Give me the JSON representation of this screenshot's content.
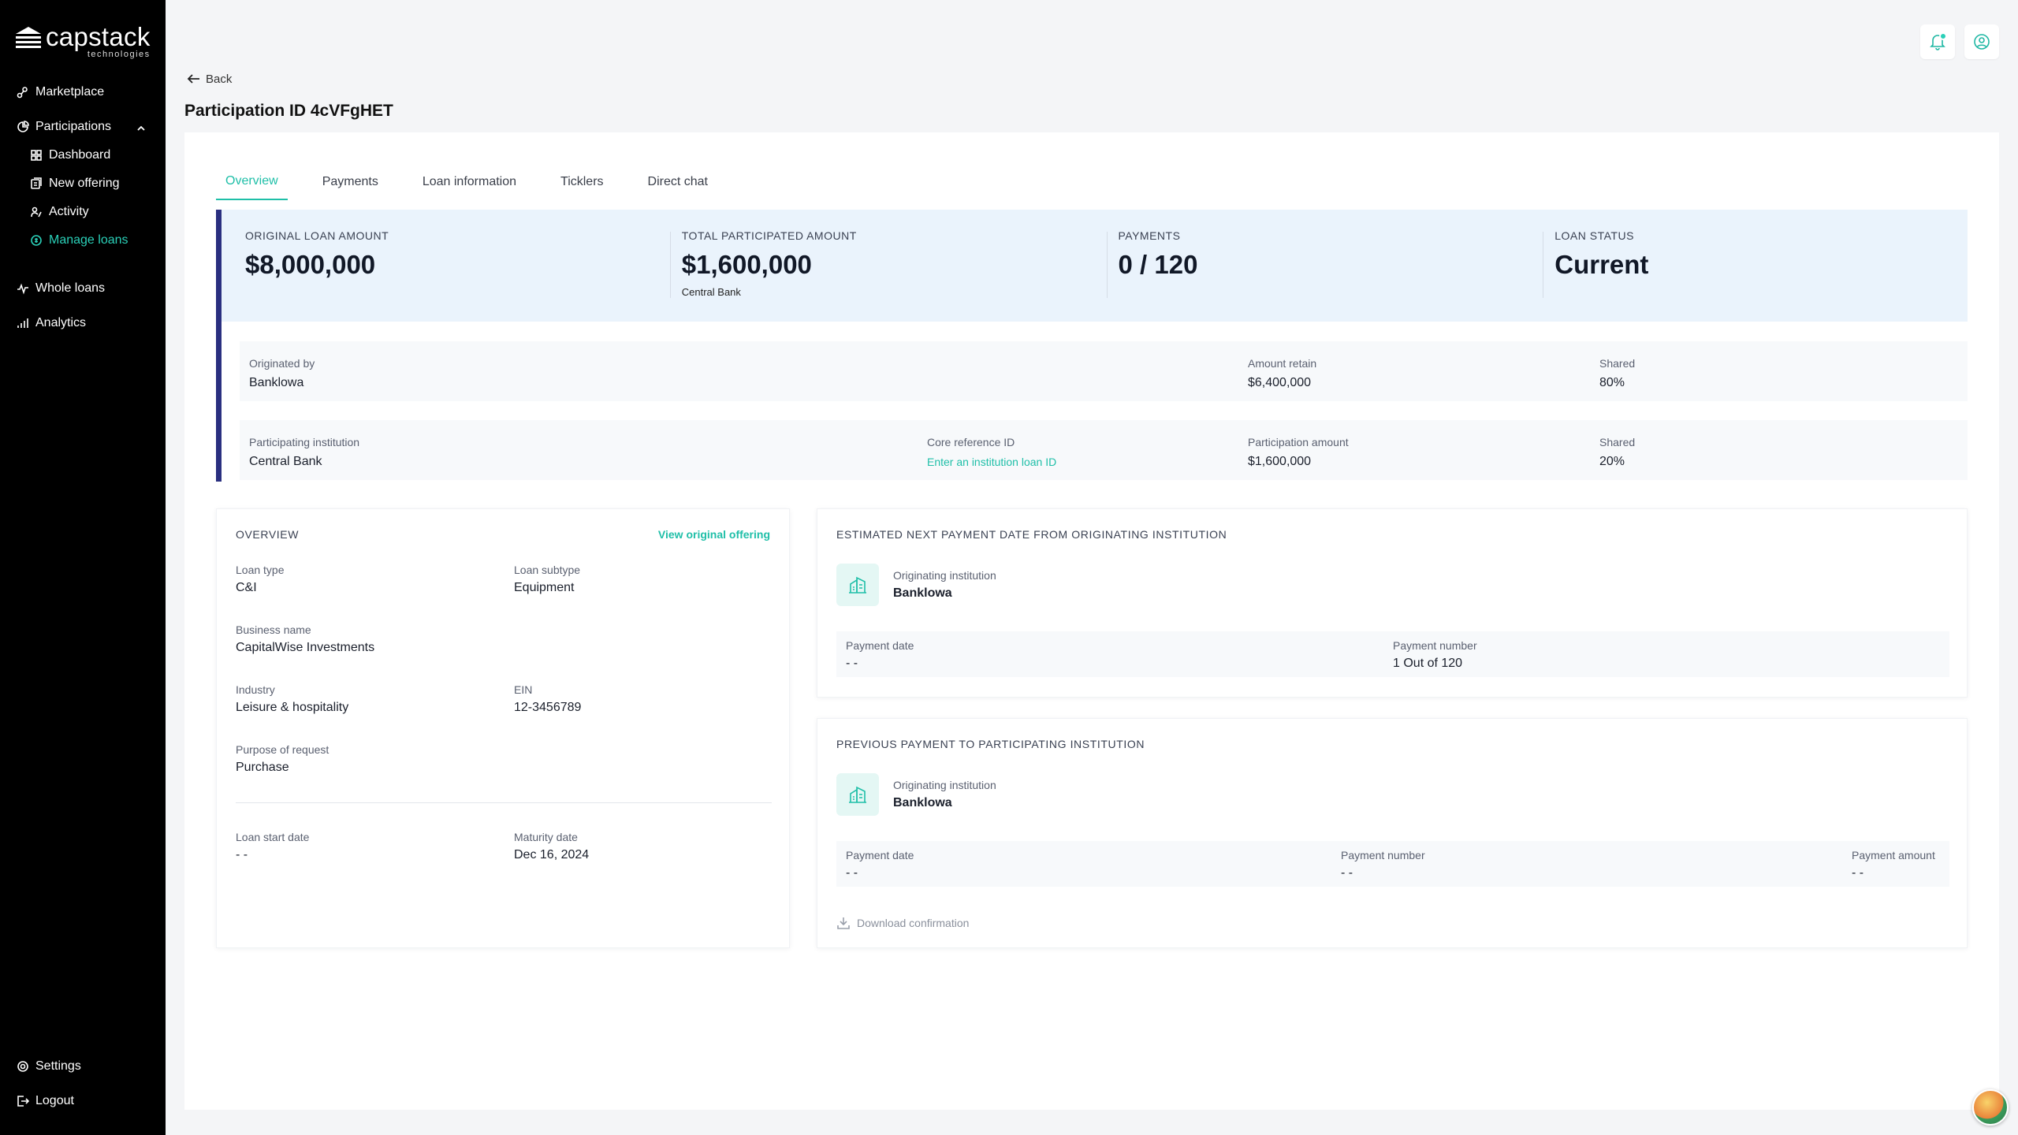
{
  "brand": {
    "name": "capstack",
    "sub": "technologies"
  },
  "nav": {
    "marketplace": "Marketplace",
    "participations": "Participations",
    "dashboard": "Dashboard",
    "new_offering": "New offering",
    "activity": "Activity",
    "manage_loans": "Manage loans",
    "whole_loans": "Whole loans",
    "analytics": "Analytics",
    "settings": "Settings",
    "logout": "Logout"
  },
  "header": {
    "back": "Back",
    "title": "Participation ID 4cVFgHET"
  },
  "tabs": [
    "Overview",
    "Payments",
    "Loan information",
    "Ticklers",
    "Direct chat"
  ],
  "stats": {
    "original_label": "ORIGINAL LOAN AMOUNT",
    "original_value": "$8,000,000",
    "participated_label": "TOTAL PARTICIPATED AMOUNT",
    "participated_value": "$1,600,000",
    "participated_sub": "Central Bank",
    "payments_label": "PAYMENTS",
    "payments_value": "0 / 120",
    "status_label": "LOAN STATUS",
    "status_value": "Current"
  },
  "origination": {
    "originated_by_label": "Originated by",
    "originated_by": "Banklowa",
    "amount_retain_label": "Amount retain",
    "amount_retain": "$6,400,000",
    "shared_label": "Shared",
    "shared": "80%"
  },
  "participation": {
    "institution_label": "Participating institution",
    "institution": "Central Bank",
    "core_ref_label": "Core reference ID",
    "core_ref_link": "Enter an institution loan ID",
    "amount_label": "Participation amount",
    "amount": "$1,600,000",
    "shared_label": "Shared",
    "shared": "20%"
  },
  "overview": {
    "title": "OVERVIEW",
    "link": "View original offering",
    "loan_type_label": "Loan type",
    "loan_type": "C&I",
    "loan_subtype_label": "Loan subtype",
    "loan_subtype": "Equipment",
    "business_label": "Business name",
    "business": "CapitalWise Investments",
    "industry_label": "Industry",
    "industry": "Leisure & hospitality",
    "ein_label": "EIN",
    "ein": "12-3456789",
    "purpose_label": "Purpose of request",
    "purpose": "Purchase",
    "start_label": "Loan start date",
    "start": "- -",
    "maturity_label": "Maturity date",
    "maturity": "Dec 16, 2024"
  },
  "next_payment": {
    "title": "ESTIMATED NEXT PAYMENT DATE FROM ORIGINATING INSTITUTION",
    "inst_label": "Originating institution",
    "inst_name": "Banklowa",
    "date_label": "Payment date",
    "date": "- -",
    "number_label": "Payment number",
    "number": "1 Out of 120"
  },
  "prev_payment": {
    "title": "PREVIOUS PAYMENT TO PARTICIPATING INSTITUTION",
    "inst_label": "Originating institution",
    "inst_name": "Banklowa",
    "date_label": "Payment date",
    "date": "- -",
    "number_label": "Payment number",
    "number": "- -",
    "amount_label": "Payment amount",
    "amount": "- -",
    "download": "Download confirmation"
  },
  "colors": {
    "accent": "#1fbfa8",
    "sidebar": "#000000",
    "summary_bar": "#2a2f80",
    "stats_bg": "#eaf3fc"
  }
}
